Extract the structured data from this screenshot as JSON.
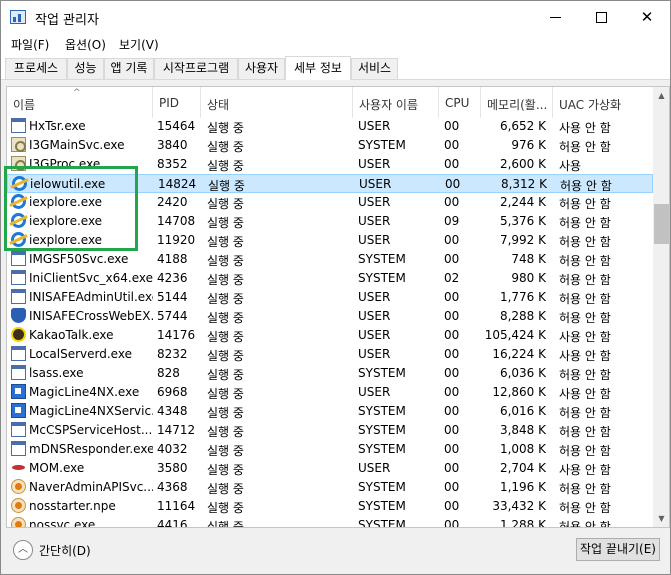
{
  "window": {
    "title": "작업 관리자"
  },
  "menu": [
    "파일(F)",
    "옵션(O)",
    "보기(V)"
  ],
  "tabs": [
    "프로세스",
    "성능",
    "앱 기록",
    "시작프로그램",
    "사용자",
    "세부 정보",
    "서비스"
  ],
  "active_tab": "세부 정보",
  "columns": [
    "이름",
    "PID",
    "상태",
    "사용자 이름",
    "CPU",
    "메모리(활...",
    "UAC 가상화"
  ],
  "rows": [
    {
      "name": "HxTsr.exe",
      "pid": "15464",
      "state": "실행 중",
      "user": "USER",
      "cpu": "00",
      "mem": "6,652 K",
      "uac": "사용 안 함",
      "icon": "window-icon"
    },
    {
      "name": "I3GMainSvc.exe",
      "pid": "3840",
      "state": "실행 중",
      "user": "SYSTEM",
      "cpu": "00",
      "mem": "976 K",
      "uac": "허용 안 함",
      "icon": "gear-icon"
    },
    {
      "name": "I3GProc.exe",
      "pid": "8352",
      "state": "실행 중",
      "user": "USER",
      "cpu": "00",
      "mem": "2,600 K",
      "uac": "사용",
      "icon": "gear-icon"
    },
    {
      "name": "ielowutil.exe",
      "pid": "14824",
      "state": "실행 중",
      "user": "USER",
      "cpu": "00",
      "mem": "8,312 K",
      "uac": "허용 안 함",
      "icon": "internet-explorer-icon"
    },
    {
      "name": "iexplore.exe",
      "pid": "2420",
      "state": "실행 중",
      "user": "USER",
      "cpu": "00",
      "mem": "2,244 K",
      "uac": "허용 안 함",
      "icon": "internet-explorer-icon"
    },
    {
      "name": "iexplore.exe",
      "pid": "14708",
      "state": "실행 중",
      "user": "USER",
      "cpu": "09",
      "mem": "5,376 K",
      "uac": "허용 안 함",
      "icon": "internet-explorer-icon"
    },
    {
      "name": "iexplore.exe",
      "pid": "11920",
      "state": "실행 중",
      "user": "USER",
      "cpu": "00",
      "mem": "7,992 K",
      "uac": "허용 안 함",
      "icon": "internet-explorer-icon"
    },
    {
      "name": "IMGSF50Svc.exe",
      "pid": "4188",
      "state": "실행 중",
      "user": "SYSTEM",
      "cpu": "00",
      "mem": "748 K",
      "uac": "허용 안 함",
      "icon": "window-icon"
    },
    {
      "name": "IniClientSvc_x64.exe",
      "pid": "4236",
      "state": "실행 중",
      "user": "SYSTEM",
      "cpu": "02",
      "mem": "980 K",
      "uac": "허용 안 함",
      "icon": "window-icon"
    },
    {
      "name": "INISAFEAdminUtil.exe",
      "pid": "5144",
      "state": "실행 중",
      "user": "USER",
      "cpu": "00",
      "mem": "1,776 K",
      "uac": "허용 안 함",
      "icon": "window-icon"
    },
    {
      "name": "INISAFECrossWebEX...",
      "pid": "5744",
      "state": "실행 중",
      "user": "USER",
      "cpu": "00",
      "mem": "8,288 K",
      "uac": "허용 안 함",
      "icon": "shield-icon"
    },
    {
      "name": "KakaoTalk.exe",
      "pid": "14176",
      "state": "실행 중",
      "user": "USER",
      "cpu": "00",
      "mem": "105,424 K",
      "uac": "사용 안 함",
      "icon": "chat-bubble-icon"
    },
    {
      "name": "LocalServerd.exe",
      "pid": "8232",
      "state": "실행 중",
      "user": "USER",
      "cpu": "00",
      "mem": "16,224 K",
      "uac": "사용 안 함",
      "icon": "window-icon"
    },
    {
      "name": "lsass.exe",
      "pid": "828",
      "state": "실행 중",
      "user": "SYSTEM",
      "cpu": "00",
      "mem": "6,036 K",
      "uac": "허용 안 함",
      "icon": "window-icon"
    },
    {
      "name": "MagicLine4NX.exe",
      "pid": "6968",
      "state": "실행 중",
      "user": "USER",
      "cpu": "00",
      "mem": "12,860 K",
      "uac": "사용 안 함",
      "icon": "blue-square-icon"
    },
    {
      "name": "MagicLine4NXServic...",
      "pid": "4348",
      "state": "실행 중",
      "user": "SYSTEM",
      "cpu": "00",
      "mem": "6,016 K",
      "uac": "허용 안 함",
      "icon": "blue-square-icon"
    },
    {
      "name": "McCSPServiceHost....",
      "pid": "14712",
      "state": "실행 중",
      "user": "SYSTEM",
      "cpu": "00",
      "mem": "3,848 K",
      "uac": "허용 안 함",
      "icon": "window-icon"
    },
    {
      "name": "mDNSResponder.exe",
      "pid": "4032",
      "state": "실행 중",
      "user": "SYSTEM",
      "cpu": "00",
      "mem": "1,008 K",
      "uac": "허용 안 함",
      "icon": "window-icon"
    },
    {
      "name": "MOM.exe",
      "pid": "3580",
      "state": "실행 중",
      "user": "USER",
      "cpu": "00",
      "mem": "2,704 K",
      "uac": "사용 안 함",
      "icon": "red-logo-icon"
    },
    {
      "name": "NaverAdminAPISvc....",
      "pid": "4368",
      "state": "실행 중",
      "user": "SYSTEM",
      "cpu": "00",
      "mem": "1,196 K",
      "uac": "허용 안 함",
      "icon": "orange-logo-icon"
    },
    {
      "name": "nosstarter.npe",
      "pid": "11164",
      "state": "실행 중",
      "user": "SYSTEM",
      "cpu": "00",
      "mem": "33,432 K",
      "uac": "허용 안 함",
      "icon": "orange-logo-icon"
    },
    {
      "name": "nossvc.exe",
      "pid": "4416",
      "state": "실행 중",
      "user": "SYSTEM",
      "cpu": "00",
      "mem": "1,288 K",
      "uac": "허용 안 함",
      "icon": "orange-logo-icon"
    }
  ],
  "selected_row_index": 3,
  "footer": {
    "collapse_label": "간단히(D)",
    "end_task_label": "작업 끝내기(E)"
  },
  "colors": {
    "selection_bg": "#cce8ff",
    "annotation_box": "#22a54b"
  }
}
